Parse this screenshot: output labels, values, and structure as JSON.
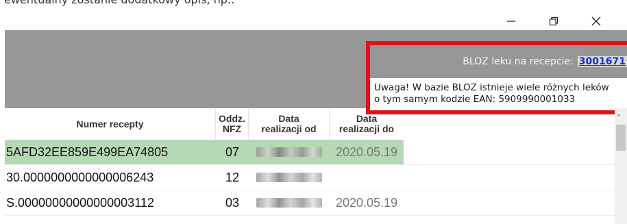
{
  "fragment_text": "ewentualny zostanie dodatkowy opis, np.:",
  "window": {
    "minimize": "—",
    "restore": "⧉",
    "close": "✕"
  },
  "bloz": {
    "label": "BLOZ leku na recepcie:",
    "code": "3001671",
    "warning_line1": "Uwaga! W bazie BLOZ istnieje wiele różnych leków",
    "warning_line2": "o tym samym kodzie EAN: 5909990001033",
    "border_color": "#e0111a"
  },
  "table": {
    "headers": {
      "number": "Numer recepty",
      "nfz_line1": "Oddz.",
      "nfz_line2": "NFZ",
      "od_line1": "Data",
      "od_line2": "realizacji od",
      "do_line1": "Data",
      "do_line2": "realizacji do"
    },
    "rows": [
      {
        "number": "5AFD32EE859E499EA74805",
        "nfz": "07",
        "date_to": "2020.05.19"
      },
      {
        "number": "30.0000000000000006243",
        "nfz": "12",
        "date_to": ""
      },
      {
        "number": "S.00000000000000003112",
        "nfz": "03",
        "date_to": "2020.05.19"
      }
    ],
    "selected_color": "#b7d8b5"
  },
  "scrollbar": {
    "up_arrow": "˄"
  }
}
